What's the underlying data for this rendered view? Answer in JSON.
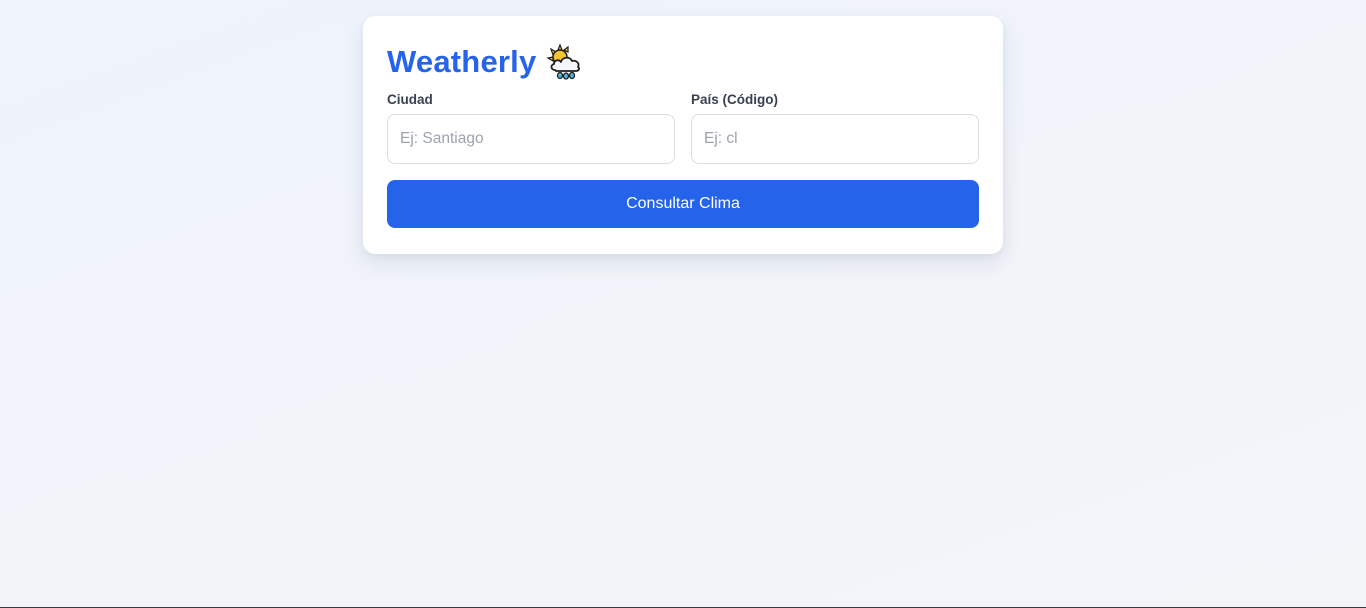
{
  "app": {
    "title": "Weatherly",
    "icon": "sun-behind-rain-cloud-icon"
  },
  "form": {
    "city": {
      "label": "Ciudad",
      "value": "",
      "placeholder": "Ej: Santiago"
    },
    "country": {
      "label": "País (Código)",
      "value": "",
      "placeholder": "Ej: cl"
    },
    "submit_label": "Consultar Clima"
  },
  "colors": {
    "accent": "#2563eb",
    "background": "#f1f4f9",
    "card": "#ffffff",
    "label": "#374151",
    "placeholder": "#9ca3af"
  }
}
